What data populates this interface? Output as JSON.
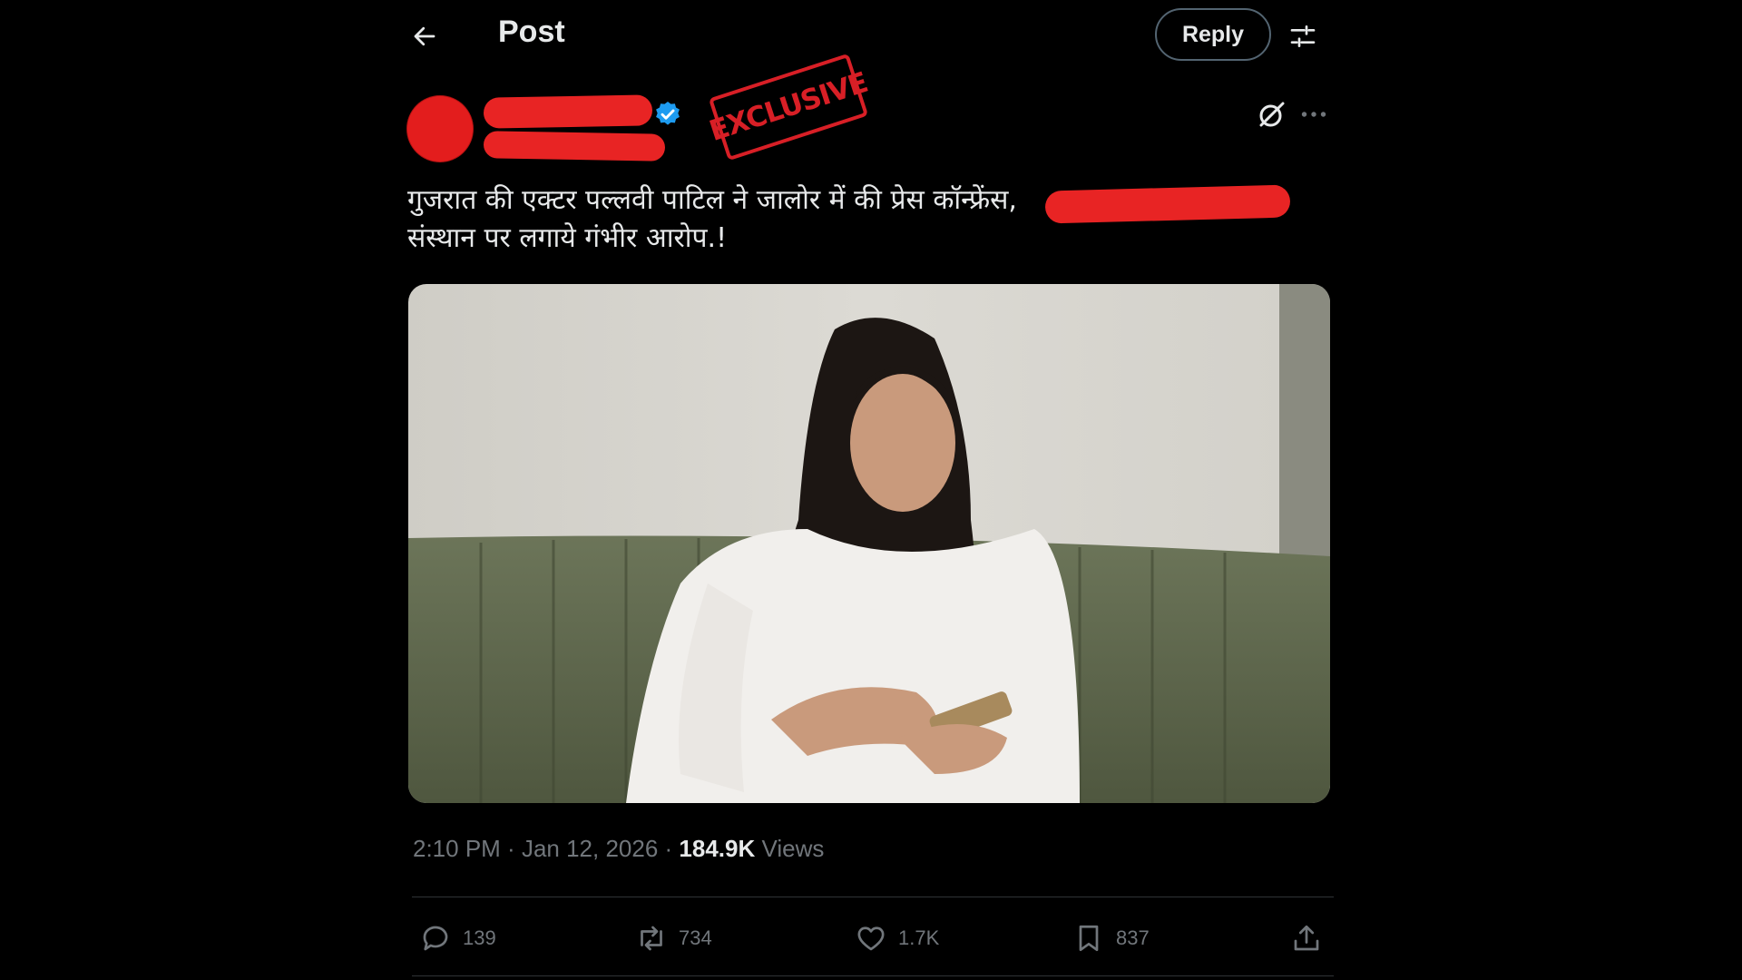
{
  "header": {
    "title": "Post",
    "reply_label": "Reply",
    "back_icon": "arrow-left-icon",
    "filter_icon": "sliders-icon"
  },
  "author": {
    "stamp_text": "EXCLUSIVE",
    "verified_icon": "verified-badge-icon"
  },
  "post": {
    "text_line1": "गुजरात की एक्टर पल्लवी पाटिल ने जालोर में की प्रेस कॉन्फ्रेंस,",
    "text_line2": "संस्थान पर लगाये गंभीर आरोप.!"
  },
  "meta": {
    "time": "2:10 PM",
    "sep1": " · ",
    "date": "Jan 12, 2026",
    "sep2": " · ",
    "views_count": "184.9K",
    "views_label": "Views"
  },
  "actions": {
    "replies": "139",
    "reposts": "734",
    "likes": "1.7K",
    "bookmarks": "837"
  },
  "colors": {
    "background": "#000000",
    "text": "#e7e9ea",
    "muted": "#71767b",
    "verified": "#1d9bf0",
    "redaction": "#e82424"
  }
}
